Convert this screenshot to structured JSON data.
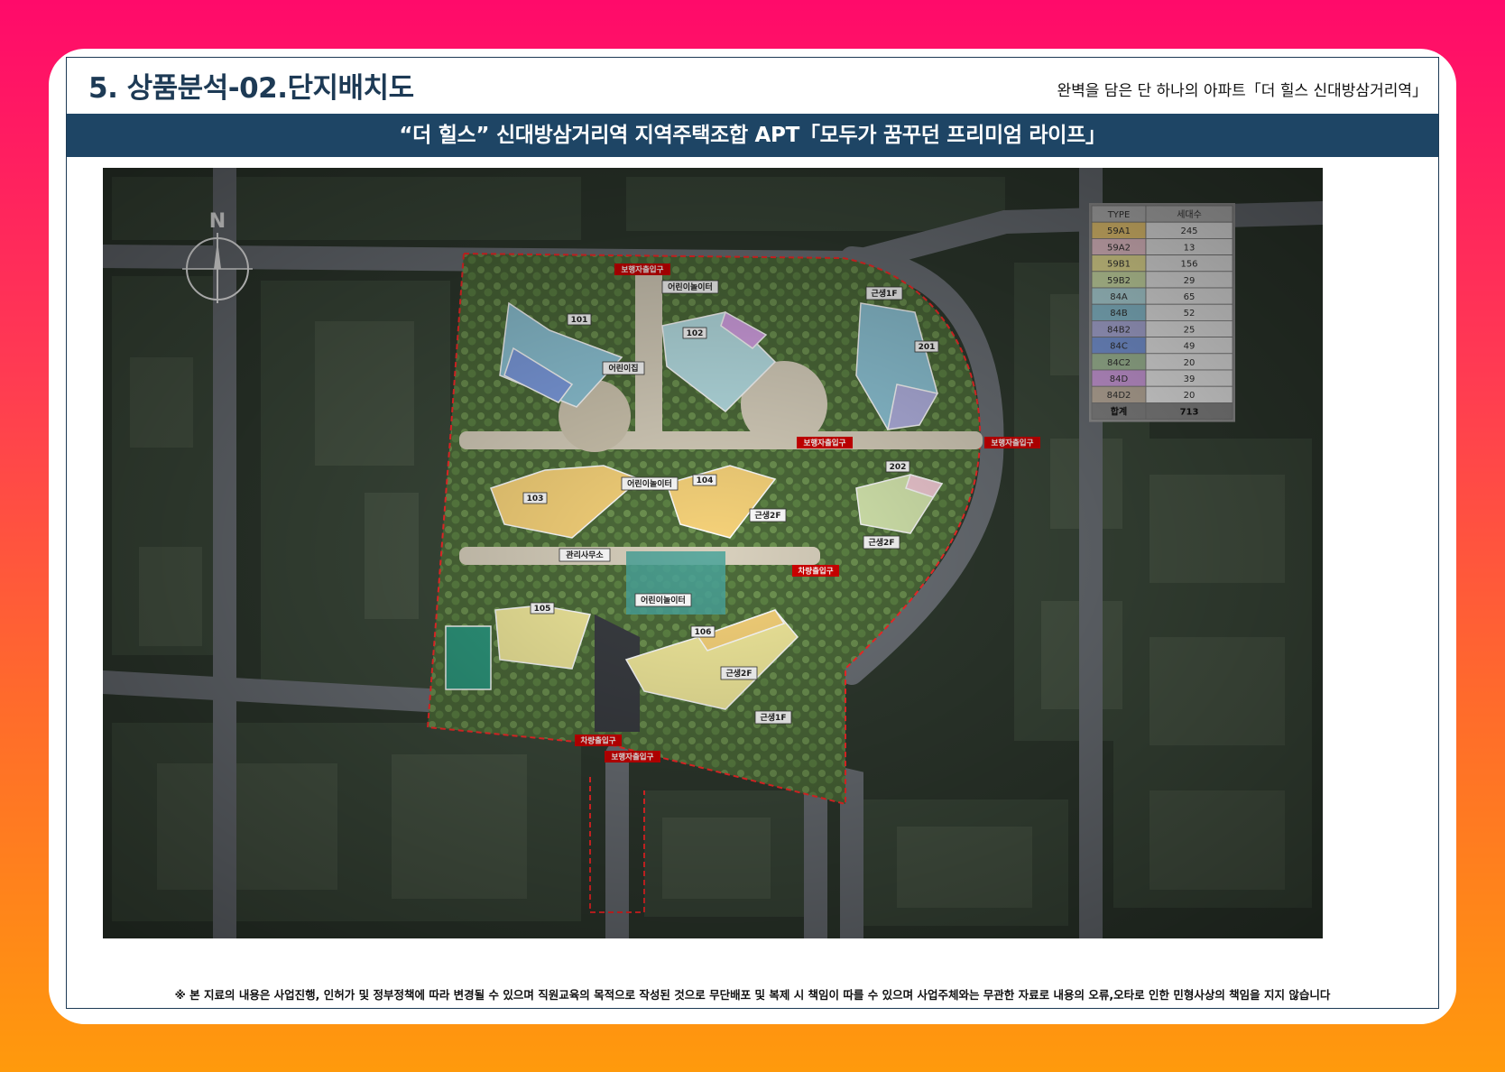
{
  "header": {
    "title": "5. 상품분석-02.단지배치도",
    "subtitle": "완벽을 담은 단 하나의 아파트「더 힐스 신대방삼거리역」"
  },
  "banner": {
    "text": "“더 힐스” 신대방삼거리역 지역주택조합 APT「모두가 꿈꾸던 프리미엄 라이프」"
  },
  "map": {
    "compass_label": "N",
    "buildings": [
      "101",
      "102",
      "103",
      "104",
      "105",
      "106",
      "201",
      "202"
    ],
    "facilities": {
      "playground_1": "어린이놀이터",
      "daycare": "어린이집",
      "playground_2": "어린이놀이터",
      "playground_3": "어린이놀이터",
      "management": "관리사무소",
      "retail_1f_a": "근생1F",
      "retail_2f_a": "근생2F",
      "retail_2f_b": "근생2F",
      "retail_2f_c": "근생2F",
      "retail_1f_b": "근생1F"
    },
    "entrances": {
      "pedestrian_top": "보행자출입구",
      "pedestrian_mid": "보행자출입구",
      "pedestrian_right": "보행자출입구",
      "vehicle_mid": "차량출입구",
      "vehicle_bottom": "차량출입구",
      "pedestrian_bottom": "보행자출입구"
    }
  },
  "unit_table": {
    "headers": [
      "TYPE",
      "세대수"
    ],
    "rows": [
      {
        "type": "59A1",
        "count": "245",
        "color": "#f7d37a"
      },
      {
        "type": "59A2",
        "count": "13",
        "color": "#f4cdd6"
      },
      {
        "type": "59B1",
        "count": "156",
        "color": "#f2ea9c"
      },
      {
        "type": "59B2",
        "count": "29",
        "color": "#d7e9b0"
      },
      {
        "type": "84A",
        "count": "65",
        "color": "#b8e1e6"
      },
      {
        "type": "84B",
        "count": "52",
        "color": "#8fc6d8"
      },
      {
        "type": "84B2",
        "count": "25",
        "color": "#b3b3e2"
      },
      {
        "type": "84C",
        "count": "49",
        "color": "#7f9fe3"
      },
      {
        "type": "84C2",
        "count": "20",
        "color": "#a9c49f"
      },
      {
        "type": "84D",
        "count": "39",
        "color": "#d6a3e6"
      },
      {
        "type": "84D2",
        "count": "20",
        "color": "#c6b7a6"
      }
    ],
    "total": {
      "label": "합계",
      "count": "713"
    }
  },
  "footer": {
    "disclaimer": "※ 본 지료의 내용은 사업진행, 인허가 및 정부정책에 따라 변경될 수 있으며 직원교육의 목적으로 작성된 것으로 무단배포 및 복제 시 책임이 따를 수 있으며 사업주체와는 무관한 자료로 내용의 오류,오타로 인한 민형사상의 책임을 지지 않습니다"
  }
}
